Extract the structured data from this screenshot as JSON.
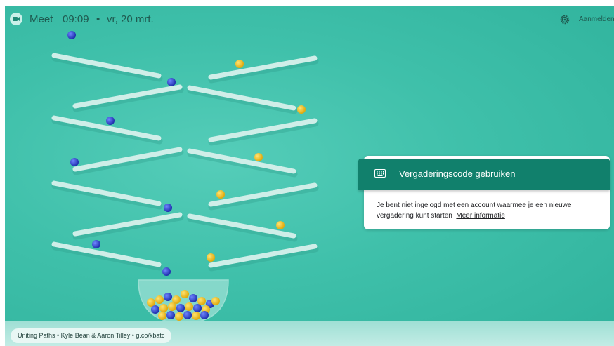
{
  "header": {
    "app_name": "Meet",
    "time": "09:09",
    "separator": "•",
    "date": "vr, 20 mrt.",
    "signin_label": "Aanmelden",
    "settings_icon": "gear-icon",
    "meet_icon": "meet-camera-icon"
  },
  "card": {
    "title": "Vergaderingscode gebruiken",
    "icon": "keyboard-icon",
    "message": "Je bent niet ingelogd met een account waarmee je een nieuwe vergadering kunt starten",
    "link": "Meer informatie"
  },
  "background": {
    "credit": "Uniting Paths • Kyle Bean & Aaron Tilley • g.co/kbatc"
  },
  "colors": {
    "background": "#3fc0aa",
    "card_header": "#11806c",
    "text_dark": "#1f5a50",
    "ball_blue": "#2f46c8",
    "ball_yellow": "#f2c21b"
  }
}
